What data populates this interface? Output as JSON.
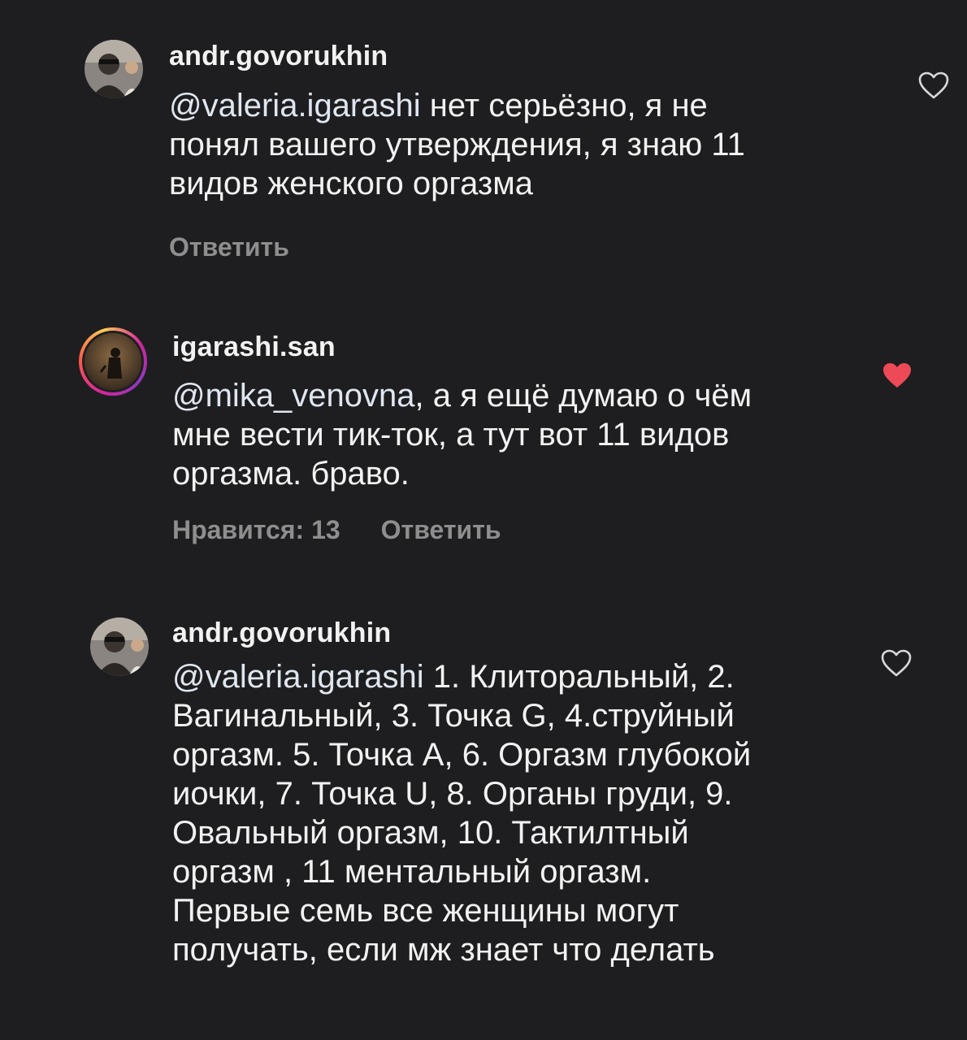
{
  "comments": [
    {
      "username": "andr.govorukhin",
      "mention": "@valeria.igarashi",
      "text_line1": " нет серьёзно,  я не",
      "text_rest": [
        "понял вашего утверждения, я знаю 11",
        "видов женского оргазма"
      ],
      "reply_label": "Ответить",
      "likes_label": "",
      "liked": false,
      "heart_icon": "heart-outline-icon"
    },
    {
      "username": "igarashi.san",
      "mention": "@mika_venovna",
      "text_line1": ", а я ещё думаю о чём",
      "text_rest": [
        "мне вести тик-ток, а тут вот 11 видов",
        "оргазма. браво."
      ],
      "likes_label": "Нравится: 13",
      "reply_label": "Ответить",
      "liked": true,
      "heart_icon": "heart-filled-icon",
      "heart_color": "#ed4956"
    },
    {
      "username": "andr.govorukhin",
      "mention": "@valeria.igarashi",
      "text_line1": " 1. Клиторальный, 2.",
      "text_rest": [
        "Вагинальный, 3. Точка G, 4.струйный",
        "оргазм. 5. Точка А, 6. Оргазм глубокой",
        "иочки, 7. Точка U, 8. Органы груди, 9.",
        "Овальный оргазм, 10. Тактилтный",
        "оргазм , 11 ментальный оргазм.",
        "Первые семь все женщины могут",
        "получать, если мж знает что делать"
      ],
      "liked": false,
      "heart_icon": "heart-outline-icon"
    }
  ],
  "colors": {
    "background": "#1e1e20",
    "text": "#f2f2f2",
    "meta": "#8e8e8e",
    "liked_heart": "#ed4956"
  }
}
